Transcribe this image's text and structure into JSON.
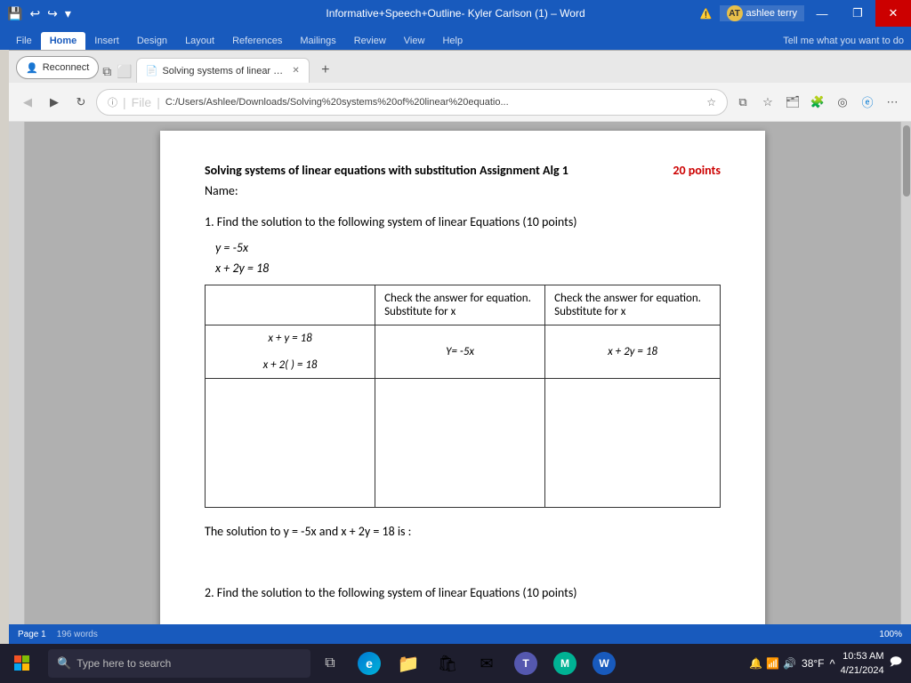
{
  "titlebar": {
    "title": "Informative+Speech+Outline- Kyler Carlson (1) – Word",
    "save_icon": "💾",
    "undo_icon": "↩",
    "redo_icon": "↪",
    "dropdown_icon": "▾",
    "warn_text": "ashlee terry",
    "user_initials": "AT",
    "minimize": "—",
    "restore": "❐",
    "close": "✕"
  },
  "word_tabs": {
    "items": [
      "File",
      "Home",
      "Insert",
      "Design",
      "Layout",
      "References",
      "Mailings",
      "Review",
      "View",
      "Help"
    ],
    "active": "Home",
    "tell": "Tell me what you want to do"
  },
  "browser": {
    "back_disabled": true,
    "refresh_icon": "↻",
    "address_info": "File",
    "address_sep": "|",
    "address_url": "C:/Users/Ashlee/Downloads/Solving%20systems%20of%20linear%20equatio...",
    "tab_label": "Solving systems of linear equatio",
    "tab_icon": "📄",
    "new_tab": "+",
    "reconnect_label": "Reconnect"
  },
  "document": {
    "title": "Solving systems of linear equations with substitution Assignment Alg 1",
    "points_label": "20 points",
    "name_label": "Name:",
    "question1": "1. Find the solution to the following system of linear Equations (10 points)",
    "eq1": "y = -5x",
    "eq2": "x + 2y = 18",
    "table": {
      "lhs_header": "",
      "lhs_eq1": "x + y = 18",
      "lhs_eq2": "x + 2(        ) = 18",
      "mid_header1": "Check the answer for equation.",
      "mid_header2": "Substitute for x",
      "mid_subst": "Y= -5x",
      "rhs_header1": "Check the answer for equation.",
      "rhs_header2": "Substitute for x",
      "rhs_subst": "x + 2y = 18"
    },
    "solution": "The solution to y = -5x and x + 2y = 18 is :",
    "question2": "2. Find the solution to the following system of linear Equations (10 points)"
  },
  "taskbar": {
    "search_placeholder": "Type here to search",
    "time": "10:53 AM",
    "date": "4/21/2024",
    "weather": "38°F",
    "win_icon": "⊞"
  },
  "colors": {
    "word_blue": "#185abd",
    "points_red": "#cc0000",
    "taskbar_bg": "#1e1e2e"
  }
}
